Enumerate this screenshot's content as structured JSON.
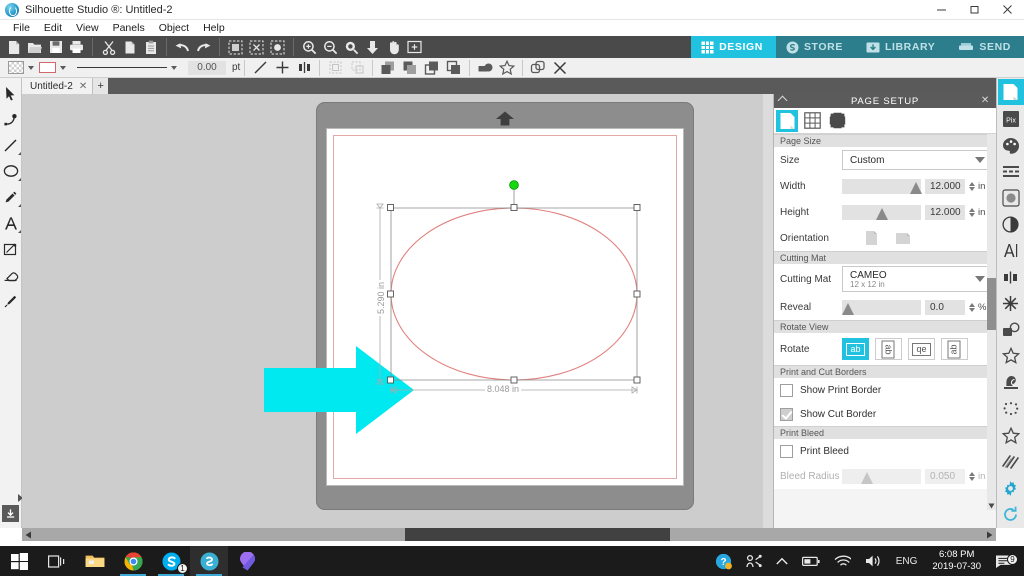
{
  "window": {
    "title": "Silhouette Studio ®: Untitled-2",
    "app_icon": "silhouette-logo-icon",
    "minimize": "–",
    "maximize": "❐",
    "close": "✕"
  },
  "menubar": {
    "items": [
      {
        "label": "File"
      },
      {
        "label": "Edit"
      },
      {
        "label": "View"
      },
      {
        "label": "Panels"
      },
      {
        "label": "Object"
      },
      {
        "label": "Help"
      }
    ]
  },
  "toolbar_main": {
    "groups": [
      {
        "buttons": [
          {
            "name": "new-document-icon",
            "tip": "New"
          },
          {
            "name": "open-document-icon",
            "tip": "Open"
          },
          {
            "name": "save-document-icon",
            "tip": "Save"
          },
          {
            "name": "print-icon",
            "tip": "Print"
          }
        ]
      },
      {
        "buttons": [
          {
            "name": "cut-scissors-icon",
            "tip": "Cut"
          },
          {
            "name": "copy-icon",
            "tip": "Copy"
          },
          {
            "name": "paste-clipboard-icon",
            "tip": "Paste"
          }
        ]
      },
      {
        "buttons": [
          {
            "name": "undo-icon",
            "tip": "Undo"
          },
          {
            "name": "redo-icon",
            "tip": "Redo"
          }
        ]
      },
      {
        "buttons": [
          {
            "name": "select-all-icon",
            "tip": "Select All"
          },
          {
            "name": "deselect-all-icon",
            "tip": "Deselect All"
          },
          {
            "name": "fill-selection-icon",
            "tip": "Fill"
          }
        ]
      },
      {
        "buttons": [
          {
            "name": "zoom-in-icon",
            "tip": "Zoom In"
          },
          {
            "name": "zoom-out-icon",
            "tip": "Zoom Out"
          },
          {
            "name": "zoom-selection-icon",
            "tip": "Zoom to Selection"
          },
          {
            "name": "fit-to-window-icon",
            "tip": "Fit to Window"
          },
          {
            "name": "pan-hand-icon",
            "tip": "Pan"
          },
          {
            "name": "zoom-region-icon",
            "tip": "Zoom Region"
          }
        ]
      }
    ]
  },
  "nav_tabs": [
    {
      "label": "DESIGN",
      "icon": "grid-icon",
      "active": true
    },
    {
      "label": "STORE",
      "icon": "store-icon",
      "active": false
    },
    {
      "label": "LIBRARY",
      "icon": "library-icon",
      "active": false
    },
    {
      "label": "SEND",
      "icon": "send-cutter-icon",
      "active": false
    }
  ],
  "toolbar_sub": {
    "fill_swatch": "checkered-transparent-swatch",
    "line_swatch": "red-line-color-swatch",
    "line_style": "solid-line-style",
    "line_thickness_value": "0.00",
    "line_thickness_unit": "pt",
    "buttons": [
      {
        "name": "draw-line-icon"
      },
      {
        "name": "transform-move-icon"
      },
      {
        "name": "align-icon"
      },
      {
        "name": "group-icon"
      },
      {
        "name": "ungroup-icon"
      },
      {
        "name": "bring-to-front-icon"
      },
      {
        "name": "bring-forward-icon"
      },
      {
        "name": "send-backward-icon"
      },
      {
        "name": "send-to-back-icon"
      },
      {
        "name": "weld-icon"
      },
      {
        "name": "modify-star-icon"
      },
      {
        "name": "offset-icon"
      },
      {
        "name": "delete-x-icon"
      }
    ]
  },
  "document_tabs": {
    "tab_label": "Untitled-2",
    "close_label": "✕",
    "add_label": "+"
  },
  "left_toolbar": {
    "tools": [
      {
        "name": "select-arrow-tool",
        "active": true
      },
      {
        "name": "edit-points-tool",
        "active": false
      },
      {
        "name": "line-tool",
        "active": false
      },
      {
        "name": "ellipse-tool",
        "active": false
      },
      {
        "name": "draw-pencil-tool",
        "active": false
      },
      {
        "name": "text-tool",
        "active": false
      },
      {
        "name": "knife-tool",
        "active": false
      },
      {
        "name": "eraser-tool",
        "active": false
      },
      {
        "name": "eyedropper-tool",
        "active": false
      }
    ],
    "bottom_button": "library-download-icon"
  },
  "canvas": {
    "mat_label": "cutting-mat",
    "mat_arrow": "mat-load-arrow",
    "annotation_arrow": "cyan-callout-arrow",
    "annotation_color": "#00E8F0",
    "selection": {
      "shape": "ellipse",
      "stroke_color": "#e0827f",
      "width_label": "8.048 in",
      "height_label": "5.290 in",
      "rotate_handle": "rotation-handle"
    }
  },
  "page_setup": {
    "title": "PAGE SETUP",
    "collapse": "^",
    "close": "✕",
    "tabs": [
      {
        "name": "page-setup-tab",
        "active": true
      },
      {
        "name": "grid-tab",
        "active": false
      },
      {
        "name": "registration-marks-tab",
        "active": false
      }
    ],
    "sections": {
      "page_size": {
        "header": "Page Size",
        "size_label": "Size",
        "size_value": "Custom",
        "width_label": "Width",
        "width_value": "12.000",
        "width_unit": "in",
        "height_label": "Height",
        "height_value": "12.000",
        "height_unit": "in",
        "orientation_label": "Orientation",
        "orientation_portrait": "portrait-icon",
        "orientation_landscape": "landscape-icon"
      },
      "cutting_mat": {
        "header": "Cutting Mat",
        "mat_label": "Cutting Mat",
        "mat_value": "CAMEO",
        "mat_sub": "12 x 12 in",
        "reveal_label": "Reveal",
        "reveal_value": "0.0",
        "reveal_unit": "%"
      },
      "rotate_view": {
        "header": "Rotate View",
        "rotate_label": "Rotate",
        "options": [
          {
            "name": "rotate-0-icon",
            "glyph": "ab",
            "active": true
          },
          {
            "name": "rotate-90-icon",
            "glyph": "ab",
            "active": false
          },
          {
            "name": "rotate-180-icon",
            "glyph": "qe",
            "active": false
          },
          {
            "name": "rotate-270-icon",
            "glyph": "ab",
            "active": false
          }
        ]
      },
      "print_cut_borders": {
        "header": "Print and Cut Borders",
        "show_print_border_label": "Show Print Border",
        "show_print_border_checked": false,
        "show_cut_border_label": "Show Cut Border",
        "show_cut_border_checked": true
      },
      "print_bleed": {
        "header": "Print Bleed",
        "print_bleed_label": "Print Bleed",
        "print_bleed_checked": false,
        "bleed_radius_label": "Bleed Radius",
        "bleed_radius_value": "0.050",
        "bleed_radius_unit": "in"
      }
    }
  },
  "right_rail": {
    "icons": [
      {
        "name": "page-setup-panel-icon",
        "active": true
      },
      {
        "name": "pixscan-panel-icon",
        "active": false
      },
      {
        "name": "color-palette-panel-icon",
        "active": false
      },
      {
        "name": "line-style-panel-icon",
        "active": false
      },
      {
        "name": "trace-panel-icon",
        "active": false
      },
      {
        "name": "fill-contrast-panel-icon",
        "active": false
      },
      {
        "name": "text-style-panel-icon",
        "active": false
      },
      {
        "name": "align-panel-icon",
        "active": false
      },
      {
        "name": "modify-panel-icon",
        "active": false
      },
      {
        "name": "offset-panel-icon",
        "active": false
      },
      {
        "name": "sketch-star-panel-icon",
        "active": false
      },
      {
        "name": "stamp-panel-icon",
        "active": false
      },
      {
        "name": "rhinestone-panel-icon",
        "active": false
      },
      {
        "name": "star-shapes-panel-icon",
        "active": false
      },
      {
        "name": "hatch-fill-panel-icon",
        "active": false
      }
    ],
    "bottom_icons": [
      {
        "name": "preferences-gear-icon"
      },
      {
        "name": "sync-refresh-icon"
      }
    ]
  },
  "scrollbars": {
    "horizontal_left_arrow": "◀",
    "horizontal_right_arrow": "▶",
    "panel_down_arrow": "▼"
  },
  "taskbar": {
    "items": [
      {
        "name": "start-button-icon",
        "label": "Start"
      },
      {
        "name": "task-view-icon",
        "label": "Task View"
      },
      {
        "name": "file-explorer-icon",
        "label": "File Explorer"
      },
      {
        "name": "chrome-icon",
        "label": "Google Chrome"
      },
      {
        "name": "skype-icon",
        "label": "Skype",
        "badge": "1"
      },
      {
        "name": "silhouette-studio-icon",
        "label": "Silhouette Studio",
        "active": true
      },
      {
        "name": "maps-pin-icon",
        "label": "Maps"
      }
    ],
    "tray": {
      "help_icon": "help-question-icon",
      "people_icon": "people-share-icon",
      "chevron_up": "show-hidden-icons-chevron",
      "battery_icon": "battery-icon",
      "wifi_icon": "wifi-icon",
      "volume_icon": "volume-icon",
      "language": "ENG",
      "time": "6:08 PM",
      "date": "2019-07-30",
      "notification_icon": "action-center-icon",
      "notification_count": "9"
    }
  }
}
